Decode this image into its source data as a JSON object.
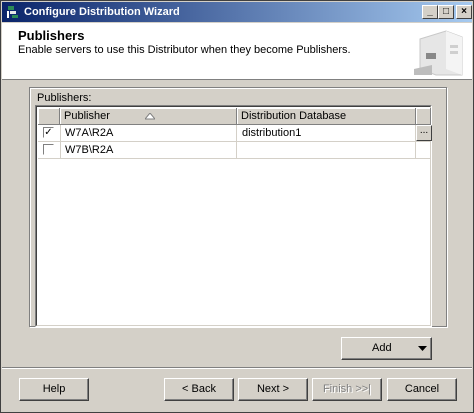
{
  "window": {
    "title": "Configure Distribution Wizard"
  },
  "header": {
    "title": "Publishers",
    "subtitle": "Enable servers to use this Distributor when they become Publishers."
  },
  "publishers": {
    "group_label": "Publishers:",
    "columns": [
      "Publisher",
      "Distribution Database"
    ],
    "rows": [
      {
        "checked": true,
        "publisher": "W7A\\R2A",
        "database": "distribution1"
      },
      {
        "checked": false,
        "publisher": "W7B\\R2A",
        "database": ""
      }
    ],
    "ellipsis": "...",
    "add_label": "Add"
  },
  "footer": {
    "help": "Help",
    "back": "< Back",
    "next": "Next >",
    "finish": "Finish >>|",
    "cancel": "Cancel"
  },
  "colors": {
    "title_start": "#0a246a",
    "title_end": "#a6caf0",
    "face": "#d4d0c8"
  },
  "icons": [
    "wizard-app-icon",
    "minimize-icon",
    "maximize-icon",
    "close-icon",
    "sort-ascending-icon",
    "dropdown-arrow-icon",
    "wizard-graphic-icon"
  ]
}
